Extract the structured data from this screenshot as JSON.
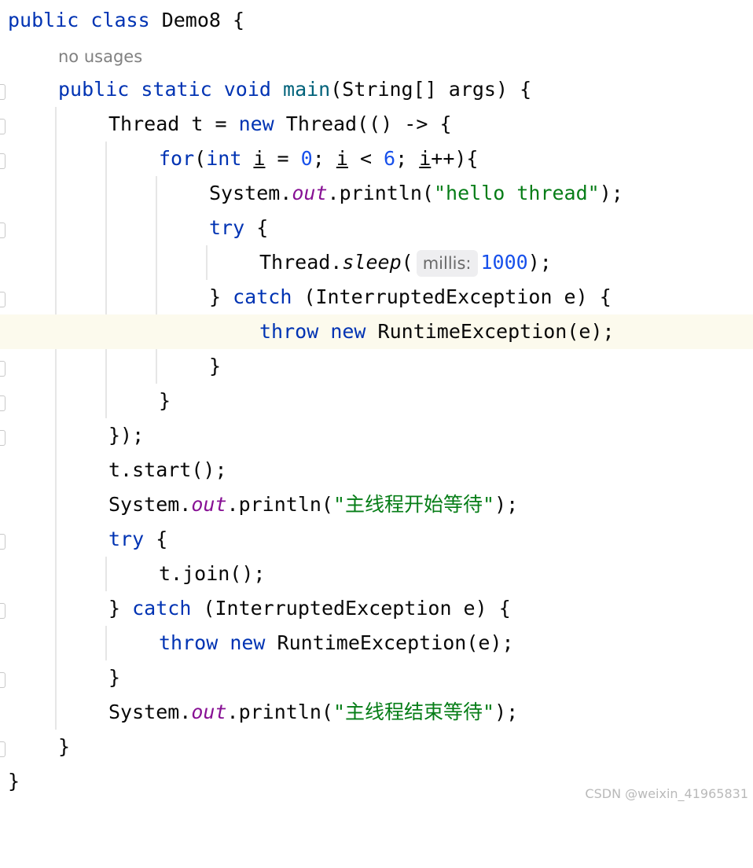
{
  "editor": {
    "usages_hint": "no usages",
    "watermark": "CSDN @weixin_41965831",
    "colors": {
      "keyword": "#0033b3",
      "method_decl": "#00627a",
      "static_field": "#871094",
      "string": "#067d17",
      "number": "#1750eb",
      "current_line": "#fcfaed"
    }
  },
  "code": {
    "l1": {
      "kw1": "public",
      "kw2": "class",
      "name": "Demo8",
      "brace": "{"
    },
    "l3": {
      "kw1": "public",
      "kw2": "static",
      "kw3": "void",
      "method": "main",
      "rest": "(String[] args) {"
    },
    "l4": {
      "pre": "Thread t = ",
      "kw": "new",
      "post": "Thread(() -> {"
    },
    "l5": {
      "kw1": "for",
      "p1": "(",
      "kw2": "int",
      "sp": " ",
      "v1": "i",
      "eq": " = ",
      "n0": "0",
      "semi1": "; ",
      "v2": "i",
      "lt": " < ",
      "n6": "6",
      "semi2": "; ",
      "v3": "i",
      "tail": "++){"
    },
    "l6": {
      "pre": "System.",
      "field": "out",
      "mid": ".println(",
      "str": "\"hello thread\"",
      "end": ");"
    },
    "l7": {
      "kw": "try",
      "rest": " {"
    },
    "l8": {
      "pre": "Thread.",
      "meth": "sleep",
      "paren": "(",
      "hint": "millis:",
      "num": "1000",
      "end": ");"
    },
    "l9": {
      "pre": "} ",
      "kw": "catch",
      "rest": " (InterruptedException e) {"
    },
    "l10": {
      "kw1": "throw",
      "kw2": "new",
      "rest": " RuntimeException(e);"
    },
    "l11": {
      "text": "}"
    },
    "l12": {
      "text": "}"
    },
    "l13": {
      "text": "});"
    },
    "l14": {
      "text": "t.start();"
    },
    "l15": {
      "pre": "System.",
      "field": "out",
      "mid": ".println(",
      "str": "\"主线程开始等待\"",
      "end": ");"
    },
    "l16": {
      "kw": "try",
      "rest": " {"
    },
    "l17": {
      "text": "t.join();"
    },
    "l18": {
      "pre": "} ",
      "kw": "catch",
      "rest": " (InterruptedException e) {"
    },
    "l19": {
      "kw1": "throw",
      "kw2": "new",
      "rest": " RuntimeException(e);"
    },
    "l20": {
      "text": "}"
    },
    "l21": {
      "pre": "System.",
      "field": "out",
      "mid": ".println(",
      "str": "\"主线程结束等待\"",
      "end": ");"
    },
    "l22": {
      "text": "}"
    },
    "l23": {
      "text": "}"
    }
  }
}
